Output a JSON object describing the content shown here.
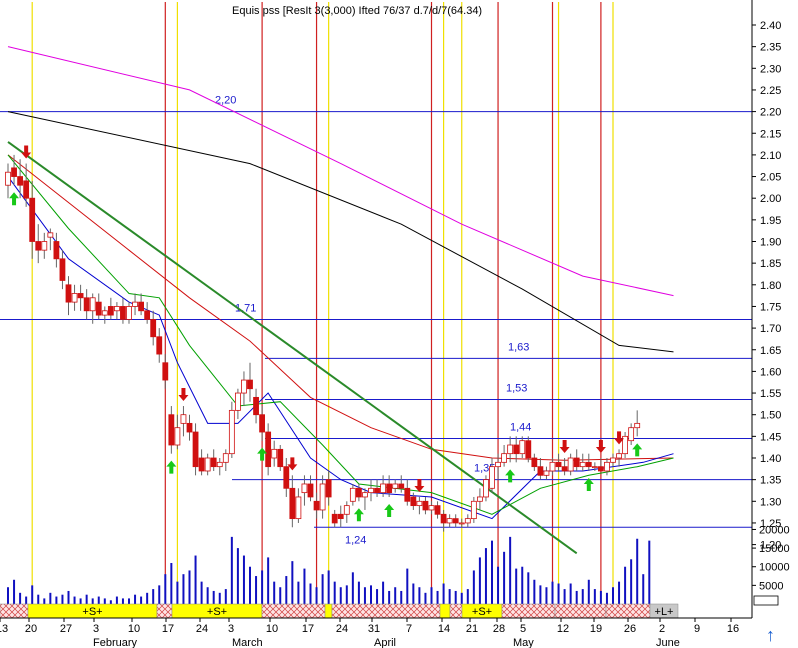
{
  "chart_data": {
    "type": "candlestick",
    "title": "Equis pss [ResIt 3(3,000) Ifted 76/37 d.7/d/7(64.34)",
    "y_axis": {
      "ylim": [
        1.12,
        2.44
      ],
      "ticks": [
        2.4,
        2.35,
        2.3,
        2.25,
        2.2,
        2.15,
        2.1,
        2.05,
        2.0,
        1.95,
        1.9,
        1.85,
        1.8,
        1.75,
        1.7,
        1.65,
        1.6,
        1.55,
        1.5,
        1.45,
        1.4,
        1.35,
        1.3,
        1.25,
        1.2
      ]
    },
    "volume_axis": {
      "ylim": [
        0,
        22000
      ],
      "ticks": [
        20000,
        15000,
        10000,
        5000
      ]
    },
    "x_axis": {
      "day_labels": [
        "13",
        "20",
        "27",
        "3",
        "10",
        "17",
        "24",
        "3",
        "10",
        "17",
        "24",
        "31",
        "7",
        "14",
        "21",
        "28",
        "5",
        "12",
        "19",
        "26",
        "2",
        "9",
        "16"
      ],
      "month_labels": [
        "February",
        "March",
        "April",
        "May",
        "June"
      ]
    },
    "horizontal_levels": [
      {
        "label": "2,20",
        "value": 2.2
      },
      {
        "label": "1,71",
        "value": 1.72
      },
      {
        "label": "1,63",
        "value": 1.63
      },
      {
        "label": "1,53",
        "value": 1.535
      },
      {
        "label": "1,44",
        "value": 1.445
      },
      {
        "label": "1,35",
        "value": 1.35
      },
      {
        "label": "1,24",
        "value": 1.24
      }
    ],
    "candles": [
      {
        "o": 2.03,
        "h": 2.08,
        "l": 2.0,
        "c": 2.06
      },
      {
        "o": 2.07,
        "h": 2.1,
        "l": 2.03,
        "c": 2.05
      },
      {
        "o": 2.05,
        "h": 2.09,
        "l": 2.0,
        "c": 2.03
      },
      {
        "o": 2.04,
        "h": 2.08,
        "l": 1.98,
        "c": 2.0
      },
      {
        "o": 2.0,
        "h": 2.04,
        "l": 1.86,
        "c": 1.9
      },
      {
        "o": 1.9,
        "h": 1.94,
        "l": 1.85,
        "c": 1.88
      },
      {
        "o": 1.88,
        "h": 1.92,
        "l": 1.86,
        "c": 1.9
      },
      {
        "o": 1.91,
        "h": 1.93,
        "l": 1.88,
        "c": 1.92
      },
      {
        "o": 1.9,
        "h": 1.92,
        "l": 1.84,
        "c": 1.86
      },
      {
        "o": 1.86,
        "h": 1.88,
        "l": 1.79,
        "c": 1.81
      },
      {
        "o": 1.8,
        "h": 1.82,
        "l": 1.73,
        "c": 1.76
      },
      {
        "o": 1.76,
        "h": 1.8,
        "l": 1.74,
        "c": 1.78
      },
      {
        "o": 1.78,
        "h": 1.8,
        "l": 1.74,
        "c": 1.77
      },
      {
        "o": 1.77,
        "h": 1.79,
        "l": 1.72,
        "c": 1.74
      },
      {
        "o": 1.74,
        "h": 1.78,
        "l": 1.71,
        "c": 1.77
      },
      {
        "o": 1.76,
        "h": 1.78,
        "l": 1.72,
        "c": 1.73
      },
      {
        "o": 1.73,
        "h": 1.75,
        "l": 1.71,
        "c": 1.74
      },
      {
        "o": 1.75,
        "h": 1.77,
        "l": 1.72,
        "c": 1.73
      },
      {
        "o": 1.74,
        "h": 1.76,
        "l": 1.72,
        "c": 1.75
      },
      {
        "o": 1.75,
        "h": 1.77,
        "l": 1.71,
        "c": 1.72
      },
      {
        "o": 1.72,
        "h": 1.76,
        "l": 1.71,
        "c": 1.75
      },
      {
        "o": 1.75,
        "h": 1.78,
        "l": 1.73,
        "c": 1.76
      },
      {
        "o": 1.76,
        "h": 1.78,
        "l": 1.73,
        "c": 1.74
      },
      {
        "o": 1.74,
        "h": 1.76,
        "l": 1.71,
        "c": 1.72
      },
      {
        "o": 1.72,
        "h": 1.74,
        "l": 1.66,
        "c": 1.68
      },
      {
        "o": 1.68,
        "h": 1.7,
        "l": 1.62,
        "c": 1.64
      },
      {
        "o": 1.62,
        "h": 1.64,
        "l": 1.56,
        "c": 1.58
      },
      {
        "o": 1.5,
        "h": 1.52,
        "l": 1.41,
        "c": 1.43
      },
      {
        "o": 1.43,
        "h": 1.5,
        "l": 1.42,
        "c": 1.47
      },
      {
        "o": 1.48,
        "h": 1.52,
        "l": 1.45,
        "c": 1.5
      },
      {
        "o": 1.48,
        "h": 1.5,
        "l": 1.44,
        "c": 1.46
      },
      {
        "o": 1.46,
        "h": 1.48,
        "l": 1.36,
        "c": 1.38
      },
      {
        "o": 1.4,
        "h": 1.42,
        "l": 1.36,
        "c": 1.37
      },
      {
        "o": 1.37,
        "h": 1.41,
        "l": 1.36,
        "c": 1.4
      },
      {
        "o": 1.4,
        "h": 1.42,
        "l": 1.37,
        "c": 1.38
      },
      {
        "o": 1.38,
        "h": 1.4,
        "l": 1.36,
        "c": 1.39
      },
      {
        "o": 1.39,
        "h": 1.42,
        "l": 1.37,
        "c": 1.41
      },
      {
        "o": 1.41,
        "h": 1.53,
        "l": 1.4,
        "c": 1.51
      },
      {
        "o": 1.51,
        "h": 1.56,
        "l": 1.49,
        "c": 1.55
      },
      {
        "o": 1.55,
        "h": 1.6,
        "l": 1.52,
        "c": 1.58
      },
      {
        "o": 1.58,
        "h": 1.62,
        "l": 1.53,
        "c": 1.56
      },
      {
        "o": 1.54,
        "h": 1.56,
        "l": 1.48,
        "c": 1.5
      },
      {
        "o": 1.5,
        "h": 1.52,
        "l": 1.44,
        "c": 1.46
      },
      {
        "o": 1.46,
        "h": 1.48,
        "l": 1.36,
        "c": 1.38
      },
      {
        "o": 1.4,
        "h": 1.44,
        "l": 1.38,
        "c": 1.42
      },
      {
        "o": 1.42,
        "h": 1.43,
        "l": 1.37,
        "c": 1.38
      },
      {
        "o": 1.38,
        "h": 1.4,
        "l": 1.31,
        "c": 1.33
      },
      {
        "o": 1.33,
        "h": 1.36,
        "l": 1.24,
        "c": 1.26
      },
      {
        "o": 1.26,
        "h": 1.33,
        "l": 1.25,
        "c": 1.31
      },
      {
        "o": 1.32,
        "h": 1.36,
        "l": 1.29,
        "c": 1.34
      },
      {
        "o": 1.34,
        "h": 1.36,
        "l": 1.3,
        "c": 1.31
      },
      {
        "o": 1.3,
        "h": 1.32,
        "l": 1.26,
        "c": 1.28
      },
      {
        "o": 1.28,
        "h": 1.36,
        "l": 1.26,
        "c": 1.34
      },
      {
        "o": 1.35,
        "h": 1.37,
        "l": 1.29,
        "c": 1.31
      },
      {
        "o": 1.27,
        "h": 1.28,
        "l": 1.24,
        "c": 1.25
      },
      {
        "o": 1.27,
        "h": 1.29,
        "l": 1.24,
        "c": 1.26
      },
      {
        "o": 1.27,
        "h": 1.3,
        "l": 1.25,
        "c": 1.29
      },
      {
        "o": 1.3,
        "h": 1.34,
        "l": 1.29,
        "c": 1.33
      },
      {
        "o": 1.33,
        "h": 1.34,
        "l": 1.3,
        "c": 1.31
      },
      {
        "o": 1.31,
        "h": 1.33,
        "l": 1.28,
        "c": 1.32
      },
      {
        "o": 1.32,
        "h": 1.35,
        "l": 1.3,
        "c": 1.33
      },
      {
        "o": 1.33,
        "h": 1.35,
        "l": 1.31,
        "c": 1.32
      },
      {
        "o": 1.32,
        "h": 1.36,
        "l": 1.31,
        "c": 1.34
      },
      {
        "o": 1.34,
        "h": 1.36,
        "l": 1.31,
        "c": 1.32
      },
      {
        "o": 1.33,
        "h": 1.35,
        "l": 1.32,
        "c": 1.34
      },
      {
        "o": 1.34,
        "h": 1.36,
        "l": 1.32,
        "c": 1.33
      },
      {
        "o": 1.33,
        "h": 1.35,
        "l": 1.29,
        "c": 1.3
      },
      {
        "o": 1.31,
        "h": 1.32,
        "l": 1.28,
        "c": 1.29
      },
      {
        "o": 1.29,
        "h": 1.31,
        "l": 1.27,
        "c": 1.3
      },
      {
        "o": 1.3,
        "h": 1.31,
        "l": 1.27,
        "c": 1.28
      },
      {
        "o": 1.28,
        "h": 1.3,
        "l": 1.27,
        "c": 1.29
      },
      {
        "o": 1.29,
        "h": 1.3,
        "l": 1.26,
        "c": 1.27
      },
      {
        "o": 1.27,
        "h": 1.28,
        "l": 1.23,
        "c": 1.25
      },
      {
        "o": 1.25,
        "h": 1.27,
        "l": 1.24,
        "c": 1.26
      },
      {
        "o": 1.26,
        "h": 1.27,
        "l": 1.24,
        "c": 1.25
      },
      {
        "o": 1.25,
        "h": 1.26,
        "l": 1.24,
        "c": 1.25
      },
      {
        "o": 1.25,
        "h": 1.27,
        "l": 1.24,
        "c": 1.26
      },
      {
        "o": 1.26,
        "h": 1.31,
        "l": 1.25,
        "c": 1.3
      },
      {
        "o": 1.3,
        "h": 1.33,
        "l": 1.28,
        "c": 1.31
      },
      {
        "o": 1.31,
        "h": 1.36,
        "l": 1.3,
        "c": 1.35
      },
      {
        "o": 1.33,
        "h": 1.4,
        "l": 1.32,
        "c": 1.38
      },
      {
        "o": 1.38,
        "h": 1.41,
        "l": 1.35,
        "c": 1.39
      },
      {
        "o": 1.39,
        "h": 1.43,
        "l": 1.38,
        "c": 1.41
      },
      {
        "o": 1.41,
        "h": 1.45,
        "l": 1.39,
        "c": 1.43
      },
      {
        "o": 1.43,
        "h": 1.45,
        "l": 1.39,
        "c": 1.41
      },
      {
        "o": 1.41,
        "h": 1.45,
        "l": 1.4,
        "c": 1.44
      },
      {
        "o": 1.44,
        "h": 1.45,
        "l": 1.39,
        "c": 1.4
      },
      {
        "o": 1.4,
        "h": 1.41,
        "l": 1.37,
        "c": 1.38
      },
      {
        "o": 1.38,
        "h": 1.4,
        "l": 1.35,
        "c": 1.36
      },
      {
        "o": 1.36,
        "h": 1.38,
        "l": 1.35,
        "c": 1.37
      },
      {
        "o": 1.37,
        "h": 1.4,
        "l": 1.36,
        "c": 1.39
      },
      {
        "o": 1.39,
        "h": 1.41,
        "l": 1.37,
        "c": 1.38
      },
      {
        "o": 1.38,
        "h": 1.4,
        "l": 1.36,
        "c": 1.37
      },
      {
        "o": 1.37,
        "h": 1.41,
        "l": 1.36,
        "c": 1.4
      },
      {
        "o": 1.4,
        "h": 1.42,
        "l": 1.37,
        "c": 1.38
      },
      {
        "o": 1.38,
        "h": 1.41,
        "l": 1.37,
        "c": 1.39
      },
      {
        "o": 1.39,
        "h": 1.41,
        "l": 1.37,
        "c": 1.38
      },
      {
        "o": 1.38,
        "h": 1.39,
        "l": 1.37,
        "c": 1.38
      },
      {
        "o": 1.38,
        "h": 1.4,
        "l": 1.37,
        "c": 1.37
      },
      {
        "o": 1.37,
        "h": 1.4,
        "l": 1.36,
        "c": 1.39
      },
      {
        "o": 1.39,
        "h": 1.41,
        "l": 1.38,
        "c": 1.4
      },
      {
        "o": 1.4,
        "h": 1.42,
        "l": 1.38,
        "c": 1.41
      },
      {
        "o": 1.41,
        "h": 1.46,
        "l": 1.4,
        "c": 1.45
      },
      {
        "o": 1.44,
        "h": 1.48,
        "l": 1.43,
        "c": 1.47
      },
      {
        "o": 1.47,
        "h": 1.51,
        "l": 1.45,
        "c": 1.48
      }
    ],
    "volume": [
      4500,
      6500,
      3000,
      2000,
      5000,
      2500,
      1500,
      3000,
      2000,
      2500,
      3500,
      2000,
      1500,
      2500,
      1500,
      2000,
      1500,
      1000,
      2000,
      1500,
      1500,
      2500,
      2000,
      3000,
      4000,
      5000,
      8000,
      11000,
      6000,
      8000,
      9000,
      13000,
      6000,
      4500,
      3500,
      3000,
      4000,
      18000,
      15000,
      13000,
      10000,
      7500,
      9000,
      12500,
      6000,
      4500,
      7500,
      11500,
      6000,
      9500,
      5500,
      4500,
      8000,
      9000,
      6000,
      4500,
      5000,
      8500,
      6000,
      4500,
      5000,
      4000,
      6000,
      3500,
      4500,
      3500,
      9500,
      5500,
      4500,
      3000,
      4500,
      3500,
      5500,
      4000,
      3500,
      3000,
      4000,
      9000,
      12500,
      15000,
      17000,
      10000,
      14000,
      18000,
      9500,
      10000,
      8500,
      6500,
      5000,
      4500,
      6000,
      5500,
      4000,
      5500,
      3500,
      4000,
      6500,
      4000,
      3500,
      3000,
      4500,
      6000,
      10000,
      12000,
      17500,
      8000,
      17000
    ],
    "moving_averages": [
      {
        "color": "#000000",
        "points": [
          [
            0,
            2.2
          ],
          [
            40,
            2.08
          ],
          [
            65,
            1.94
          ],
          [
            85,
            1.79
          ],
          [
            101,
            1.66
          ],
          [
            110,
            1.645
          ]
        ]
      },
      {
        "color": "#e000e0",
        "points": [
          [
            0,
            2.35
          ],
          [
            30,
            2.25
          ],
          [
            55,
            2.08
          ],
          [
            75,
            1.94
          ],
          [
            95,
            1.82
          ],
          [
            110,
            1.775
          ]
        ]
      },
      {
        "color": "#d01010",
        "points": [
          [
            0,
            2.1
          ],
          [
            20,
            1.88
          ],
          [
            30,
            1.77
          ],
          [
            40,
            1.67
          ],
          [
            50,
            1.54
          ],
          [
            60,
            1.47
          ],
          [
            70,
            1.42
          ],
          [
            80,
            1.4
          ],
          [
            92,
            1.395
          ],
          [
            110,
            1.4
          ]
        ]
      },
      {
        "color": "#0000d0",
        "points": [
          [
            0,
            2.05
          ],
          [
            10,
            1.86
          ],
          [
            20,
            1.76
          ],
          [
            25,
            1.73
          ],
          [
            28,
            1.62
          ],
          [
            33,
            1.48
          ],
          [
            38,
            1.48
          ],
          [
            43,
            1.55
          ],
          [
            50,
            1.4
          ],
          [
            55,
            1.35
          ],
          [
            60,
            1.32
          ],
          [
            70,
            1.31
          ],
          [
            80,
            1.26
          ],
          [
            88,
            1.37
          ],
          [
            95,
            1.37
          ],
          [
            105,
            1.39
          ],
          [
            110,
            1.41
          ]
        ]
      },
      {
        "color": "#00a000",
        "points": [
          [
            0,
            2.1
          ],
          [
            10,
            1.93
          ],
          [
            20,
            1.78
          ],
          [
            25,
            1.77
          ],
          [
            30,
            1.66
          ],
          [
            38,
            1.52
          ],
          [
            45,
            1.53
          ],
          [
            52,
            1.43
          ],
          [
            58,
            1.34
          ],
          [
            70,
            1.32
          ],
          [
            80,
            1.27
          ],
          [
            88,
            1.33
          ],
          [
            96,
            1.36
          ],
          [
            104,
            1.38
          ],
          [
            110,
            1.4
          ]
        ]
      }
    ],
    "trendlines": [
      {
        "color": "#2a8a2a",
        "from": [
          0,
          2.13
        ],
        "to": [
          94,
          1.18
        ]
      }
    ],
    "signals": {
      "up": [
        1,
        27,
        42,
        58,
        63,
        83,
        96,
        104
      ],
      "down": [
        3,
        29,
        47,
        68,
        92,
        98,
        101
      ]
    },
    "vertical_lines": {
      "red": [
        26,
        42,
        51,
        70,
        81,
        90,
        98
      ],
      "yellow": [
        4,
        28,
        53,
        72,
        75,
        91,
        100
      ]
    },
    "phase_bar": [
      {
        "type": "hatch",
        "label": ""
      },
      {
        "type": "yellow",
        "label": "+S+"
      },
      {
        "type": "hatch",
        "label": ""
      },
      {
        "type": "yellow",
        "label": "+S+"
      },
      {
        "type": "hatch",
        "label": ""
      },
      {
        "type": "yellow",
        "label": ""
      },
      {
        "type": "hatch",
        "label": ""
      },
      {
        "type": "yellow",
        "label": ""
      },
      {
        "type": "hatch",
        "label": ""
      },
      {
        "type": "yellow",
        "label": "+S+"
      },
      {
        "type": "hatch",
        "label": ""
      },
      {
        "type": "hatch",
        "label": ""
      },
      {
        "type": "hatch",
        "label": ""
      },
      {
        "type": "gray",
        "label": "+L+"
      }
    ],
    "nav_arrow_glyph": "↑"
  }
}
